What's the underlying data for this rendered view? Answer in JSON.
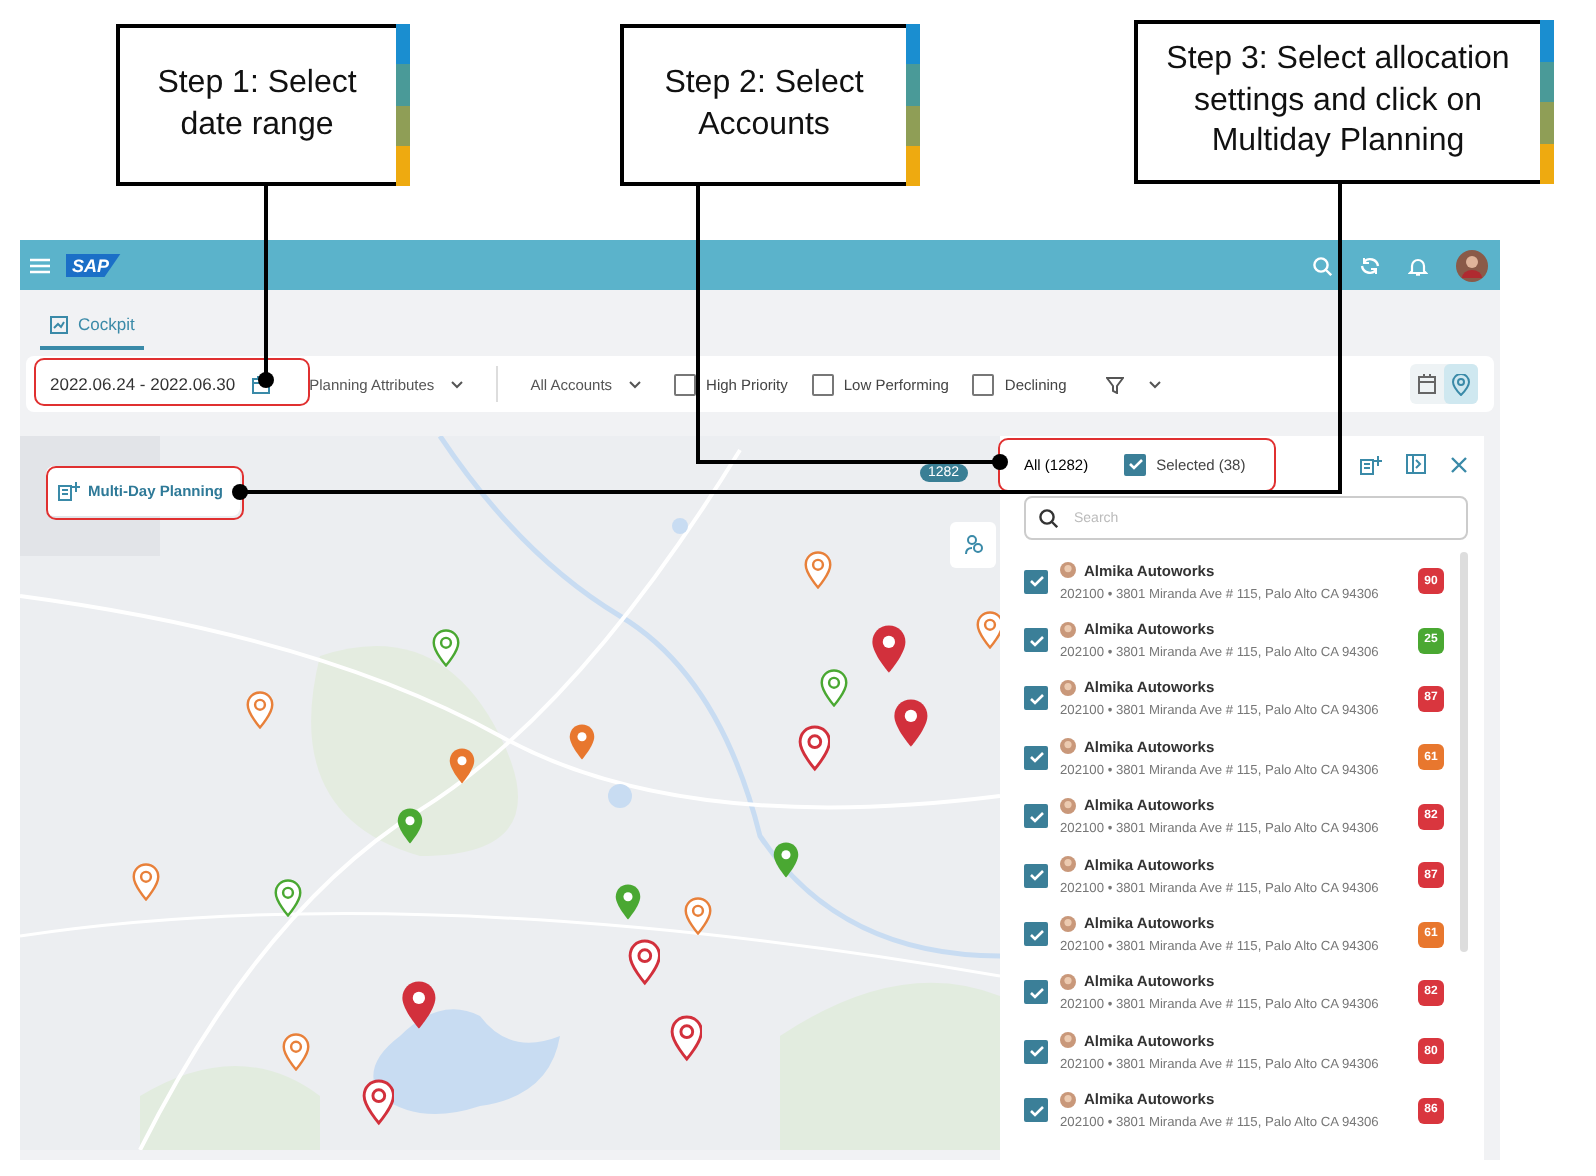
{
  "callouts": [
    {
      "text": "Step 1: Select date range"
    },
    {
      "text": "Step 2: Select Accounts"
    },
    {
      "text": "Step 3: Select allocation settings and click on Multiday Planning"
    }
  ],
  "header": {
    "logo": "SAP"
  },
  "tabs": [
    {
      "label": "Cockpit",
      "selected": true
    }
  ],
  "filters": {
    "date_range": "2022.06.24 - 2022.06.30",
    "dropdowns": [
      "Planning Attributes",
      "All Accounts"
    ],
    "checkboxes": [
      {
        "label": "High Priority",
        "checked": false
      },
      {
        "label": "Low Performing",
        "checked": false
      },
      {
        "label": "Declining",
        "checked": false
      }
    ],
    "views": [
      {
        "kind": "calendar",
        "selected": false
      },
      {
        "kind": "map",
        "selected": true
      }
    ]
  },
  "map": {
    "button": "Multi-Day Planning",
    "cluster_count": "1282",
    "pins": [
      {
        "color": "#e8803a",
        "kind": "outline"
      },
      {
        "color": "#d2303c",
        "kind": "filled"
      },
      {
        "color": "#e8803a",
        "kind": "outline"
      },
      {
        "color": "#4aa832",
        "kind": "outline"
      },
      {
        "color": "#4aa832",
        "kind": "outline"
      },
      {
        "color": "#d2303c",
        "kind": "filled"
      },
      {
        "color": "#d2303c",
        "kind": "outline"
      },
      {
        "color": "#e8803a",
        "kind": "outline"
      },
      {
        "color": "#e8772e",
        "kind": "filled"
      },
      {
        "color": "#e8772e",
        "kind": "filled"
      },
      {
        "color": "#4aa832",
        "kind": "filled"
      },
      {
        "color": "#4aa832",
        "kind": "filled"
      },
      {
        "color": "#e8803a",
        "kind": "outline"
      },
      {
        "color": "#4aa832",
        "kind": "outline"
      },
      {
        "color": "#4aa832",
        "kind": "filled"
      },
      {
        "color": "#e8803a",
        "kind": "outline"
      },
      {
        "color": "#d2303c",
        "kind": "outline"
      },
      {
        "color": "#d2303c",
        "kind": "filled"
      },
      {
        "color": "#d2303c",
        "kind": "outline"
      },
      {
        "color": "#e8803a",
        "kind": "outline"
      },
      {
        "color": "#d2303c",
        "kind": "outline"
      }
    ]
  },
  "panel": {
    "all_label": "All (1282)",
    "selected_filter": {
      "label": "Selected (38)",
      "checked": true
    },
    "search": {
      "placeholder": "Search"
    },
    "rows": [
      {
        "name": "Almika Autoworks",
        "detail": "202100 • 3801 Miranda Ave # 115, Palo Alto CA 94306",
        "checked": true,
        "score": "90",
        "color": "#d9363e"
      },
      {
        "name": "Almika Autoworks",
        "detail": "202100 • 3801 Miranda Ave # 115, Palo Alto CA 94306",
        "checked": true,
        "score": "25",
        "color": "#4aa832"
      },
      {
        "name": "Almika Autoworks",
        "detail": "202100 • 3801 Miranda Ave # 115, Palo Alto CA 94306",
        "checked": true,
        "score": "87",
        "color": "#d9363e"
      },
      {
        "name": "Almika Autoworks",
        "detail": "202100 • 3801 Miranda Ave # 115, Palo Alto CA 94306",
        "checked": true,
        "score": "61",
        "color": "#e8772e"
      },
      {
        "name": "Almika Autoworks",
        "detail": "202100 • 3801 Miranda Ave # 115, Palo Alto CA 94306",
        "checked": true,
        "score": "82",
        "color": "#d9363e"
      },
      {
        "name": "Almika Autoworks",
        "detail": "202100 • 3801 Miranda Ave # 115, Palo Alto CA 94306",
        "checked": true,
        "score": "87",
        "color": "#d9363e"
      },
      {
        "name": "Almika Autoworks",
        "detail": "202100 • 3801 Miranda Ave # 115, Palo Alto CA 94306",
        "checked": true,
        "score": "61",
        "color": "#e8772e"
      },
      {
        "name": "Almika Autoworks",
        "detail": "202100 • 3801 Miranda Ave # 115, Palo Alto CA 94306",
        "checked": true,
        "score": "82",
        "color": "#d9363e"
      },
      {
        "name": "Almika Autoworks",
        "detail": "202100 • 3801 Miranda Ave # 115, Palo Alto CA 94306",
        "checked": true,
        "score": "80",
        "color": "#d9363e"
      },
      {
        "name": "Almika Autoworks",
        "detail": "202100 • 3801 Miranda Ave # 115, Palo Alto CA 94306",
        "checked": true,
        "score": "86",
        "color": "#d9363e"
      }
    ]
  }
}
